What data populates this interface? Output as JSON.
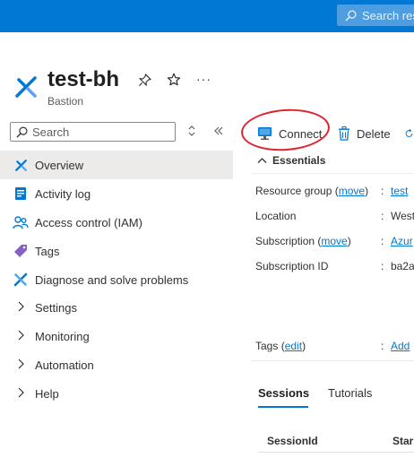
{
  "topbar": {
    "search_placeholder": "Search res"
  },
  "header": {
    "title": "test-bh",
    "subtitle": "Bastion"
  },
  "sidebar": {
    "search_placeholder": "Search",
    "items": [
      {
        "label": "Overview",
        "icon": "bastion-icon",
        "active": true
      },
      {
        "label": "Activity log",
        "icon": "activity-log-icon"
      },
      {
        "label": "Access control (IAM)",
        "icon": "people-icon"
      },
      {
        "label": "Tags",
        "icon": "tag-icon"
      },
      {
        "label": "Diagnose and solve problems",
        "icon": "wrench-icon"
      },
      {
        "label": "Settings",
        "icon": "chevron-right-icon"
      },
      {
        "label": "Monitoring",
        "icon": "chevron-right-icon"
      },
      {
        "label": "Automation",
        "icon": "chevron-right-icon"
      },
      {
        "label": "Help",
        "icon": "chevron-right-icon"
      }
    ]
  },
  "toolbar": {
    "connect_label": "Connect",
    "delete_label": "Delete"
  },
  "essentials": {
    "heading": "Essentials",
    "resource_group_label": "Resource group",
    "resource_group_move": "move",
    "resource_group_value": "test",
    "location_label": "Location",
    "location_value": "West",
    "subscription_label": "Subscription",
    "subscription_move": "move",
    "subscription_value": "Azur",
    "subscription_id_label": "Subscription ID",
    "subscription_id_value": "ba2a",
    "tags_label": "Tags",
    "tags_edit": "edit",
    "tags_value": "Add"
  },
  "tabs": [
    "Sessions",
    "Tutorials"
  ],
  "table": {
    "columns": [
      "SessionId",
      "Star"
    ]
  },
  "colors": {
    "accent": "#0078d4",
    "annotation": "#e0222d"
  }
}
